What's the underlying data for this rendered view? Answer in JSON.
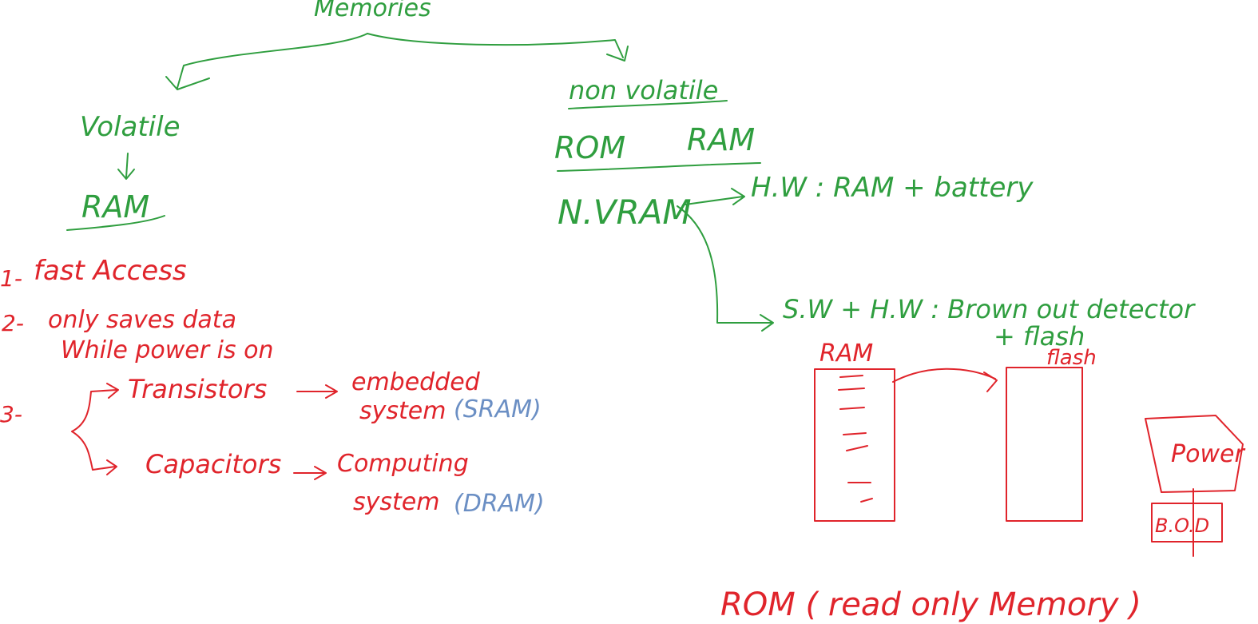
{
  "colors": {
    "green_ink": "#2f9e3f",
    "red_ink": "#e0242b",
    "blue_ink": "#6b8fc4"
  },
  "tree": {
    "root": "Memories",
    "volatile": {
      "label": "Volatile",
      "child": "RAM"
    },
    "nonvolatile": {
      "label": "non volatile",
      "items": [
        "ROM",
        "RAM"
      ],
      "nvram": "N.VRAM"
    }
  },
  "nvram_branches": {
    "hw": "H.W : RAM + battery",
    "swhw": "S.W + H.W : Brown out detector",
    "flash_note": "+ flash"
  },
  "ram_properties": {
    "p1_num": "1-",
    "p1_text": "fast Access",
    "p2_num": "2-",
    "p2_line1": "only saves data",
    "p2_line2": "While power is on",
    "p3_num": "3-",
    "transistors": "Transistors",
    "embedded_line1": "embedded",
    "embedded_line2": "system",
    "sram": "(SRAM)",
    "capacitors": "Capacitors",
    "computing_line1": "Computing",
    "computing_line2": "system",
    "dram": "(DRAM)"
  },
  "bod_diagram": {
    "ram_label": "RAM",
    "flash_label": "flash",
    "power_label": "Power",
    "bod_label": "B.O.D"
  },
  "rom_note": "ROM ( read only Memory )"
}
